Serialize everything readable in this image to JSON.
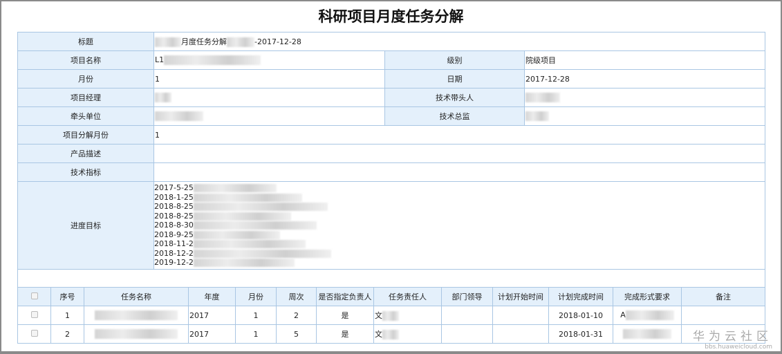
{
  "page_title": "科研项目月度任务分解",
  "form": {
    "title_label": "标题",
    "title_value_part": "月度任务分解",
    "title_value_suffix": "-2017-12-28",
    "project_name_label": "项目名称",
    "project_name_value": "L1",
    "level_label": "级别",
    "level_value": "院级项目",
    "month_label": "月份",
    "month_value": "1",
    "date_label": "日期",
    "date_value": "2017-12-28",
    "manager_label": "项目经理",
    "tech_lead_label": "技术带头人",
    "lead_unit_label": "牵头单位",
    "tech_director_label": "技术总监",
    "decomp_month_label": "项目分解月份",
    "decomp_month_value": "1",
    "product_desc_label": "产品描述",
    "tech_index_label": "技术指标",
    "progress_label": "进度目标",
    "progress_items": [
      "2017-5-25",
      "2018-1-25",
      "2018-8-25",
      "2018-8-25",
      "2018-8-30",
      "2018-9-25",
      "2018-11-2",
      "2018-12-2",
      "2019-12-2"
    ]
  },
  "grid": {
    "headers": [
      "序号",
      "任务名称",
      "年度",
      "月份",
      "周次",
      "是否指定负责人",
      "任务责任人",
      "部门领导",
      "计划开始时间",
      "计划完成时间",
      "完成形式要求",
      "备注"
    ],
    "rows": [
      {
        "no": "1",
        "year": "2017",
        "month": "1",
        "week": "2",
        "assigned": "是",
        "owner": "文",
        "end": "2018-01-10",
        "form": "A"
      },
      {
        "no": "2",
        "year": "2017",
        "month": "1",
        "week": "5",
        "assigned": "是",
        "owner": "文",
        "end": "2018-01-31",
        "form": ""
      }
    ]
  },
  "watermark": {
    "cn": "华为云社区",
    "url": "bbs.huaweicloud.com"
  }
}
